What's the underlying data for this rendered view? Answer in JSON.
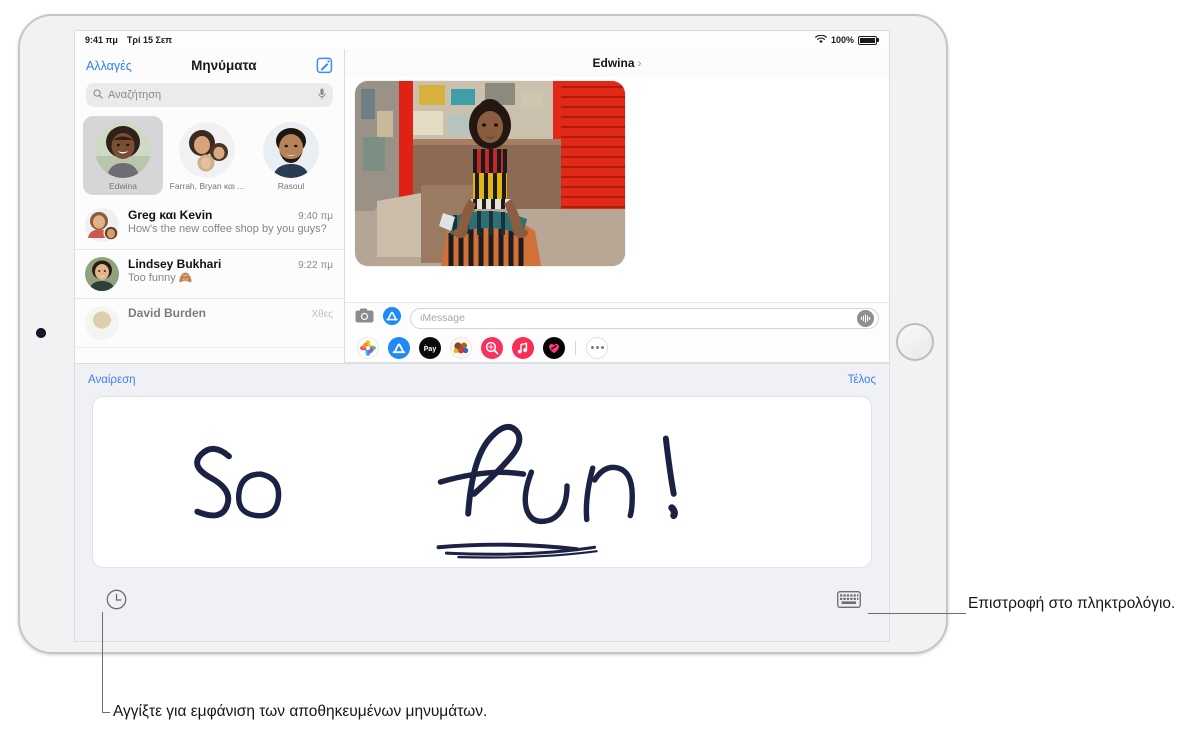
{
  "status_bar": {
    "time": "9:41 πμ",
    "date": "Τρί 15 Σεπ",
    "battery_percent": "100%",
    "wifi_icon": "wifi-icon",
    "battery_icon": "battery-icon"
  },
  "sidebar": {
    "edit_label": "Αλλαγές",
    "title": "Μηνύματα",
    "compose_icon": "compose-icon",
    "search": {
      "placeholder": "Αναζήτηση",
      "search_icon": "search-icon",
      "mic_icon": "microphone-icon"
    },
    "pinned": [
      {
        "name": "Edwina",
        "selected": true
      },
      {
        "name": "Farrah, Bryan και ...",
        "selected": false
      },
      {
        "name": "Rasoul",
        "selected": false
      }
    ],
    "conversations": [
      {
        "name": "Greg και Kevin",
        "time": "9:40 πμ",
        "preview": "How's the new coffee shop by you guys?"
      },
      {
        "name": "Lindsey Bukhari",
        "time": "9:22 πμ",
        "preview": "Too funny 🙈"
      },
      {
        "name": "David Burden",
        "time": "Χθες",
        "preview": ""
      }
    ]
  },
  "conversation": {
    "title": "Edwina",
    "chevron": "›",
    "attachment_alt": "photo-message",
    "input": {
      "placeholder": "iMessage",
      "camera_icon": "camera-icon",
      "appstore_icon": "app-store-icon",
      "audio_icon": "audio-waveform-icon"
    },
    "app_drawer": {
      "apps": [
        {
          "name": "photos-app-icon",
          "color": "#ffffff"
        },
        {
          "name": "app-store-icon",
          "color": "#1f8af5"
        },
        {
          "name": "apple-pay-icon",
          "color": "#0a0a0a"
        },
        {
          "name": "images-app-icon",
          "color": "#d9c7b0"
        },
        {
          "name": "image-search-icon",
          "color": "#f5335e"
        },
        {
          "name": "music-app-icon",
          "color": "#fb2d55"
        },
        {
          "name": "digital-touch-icon",
          "color": "#050505"
        }
      ],
      "more_label": "more-apps-button"
    }
  },
  "handwriting": {
    "undo_label": "Αναίρεση",
    "done_label": "Τέλος",
    "drawing_text": "So fun!",
    "ink_color": "#1b2244",
    "recent_icon": "clock-icon",
    "keyboard_icon": "keyboard-icon"
  },
  "callouts": [
    {
      "id": "keyboard-callout",
      "text": "Επιστροφή στο πληκτρολόγιο."
    },
    {
      "id": "saved-messages-callout",
      "text": "Αγγίξτε για εμφάνιση των αποθηκευμένων μηνυμάτων."
    }
  ],
  "colors": {
    "accent_blue": "#3d7ef7",
    "panel_bg": "#f0f1f5",
    "selected_pin": "#d6d6d8"
  }
}
